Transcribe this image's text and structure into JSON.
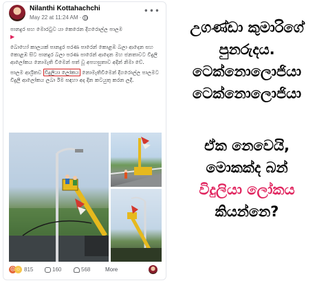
{
  "post": {
    "author": "Nilanthi Kottahachchi",
    "date": "May 22 at 11:24 AM",
    "separator": "·",
    "caption": {
      "line1": "පානදුර සහ මොරටුව යා කෙරෙන දිගරොල්ල පාලම",
      "flag": "▶",
      "paragraph2": "බොහෝ කාලයක් පානදුර පරණ පාරෙන් කොළඹ බලා ආදෙන සහ කොළඹ සිට පානදුර බලා පරණ පාරෙන් ආදෙන මහ ජනතාවට විදුලි ආලෝකය නොමැති වීමෙන් පත් වූ අපහසුතාව අදින් නිමා වේ.",
      "paragraph3_before": "පාලම ආශ්‍රිතව ",
      "paragraph3_highlight": "විදුලියා ලෝකය",
      "paragraph3_after": " නොමැතිවීමෙන් දිගරොල්ල පාලමට විදුලි ආලෝකය ලබා ඊම සඳහා අද දින කටයුතු කරන ලදී."
    },
    "reactions": {
      "count": "815",
      "comments": "160",
      "shares": "568",
      "more": "More"
    },
    "more_menu": "•••"
  },
  "commentary": {
    "line1": "උගණ්ඩා කුමාරිගේ",
    "line2": "පුනරුදය.",
    "line3": "ටෙක්නොලොජියා",
    "line4": "ටෙක්නොලොජියා",
    "line5": "ඒක නෙවෙයි,",
    "line6": "මොකක්ද බන්",
    "line7": "විදුලියා ලෝකය",
    "line8": "කියන්නෙ?"
  },
  "colors": {
    "highlight_border": "#d32020",
    "accent_red": "#e0245e"
  }
}
